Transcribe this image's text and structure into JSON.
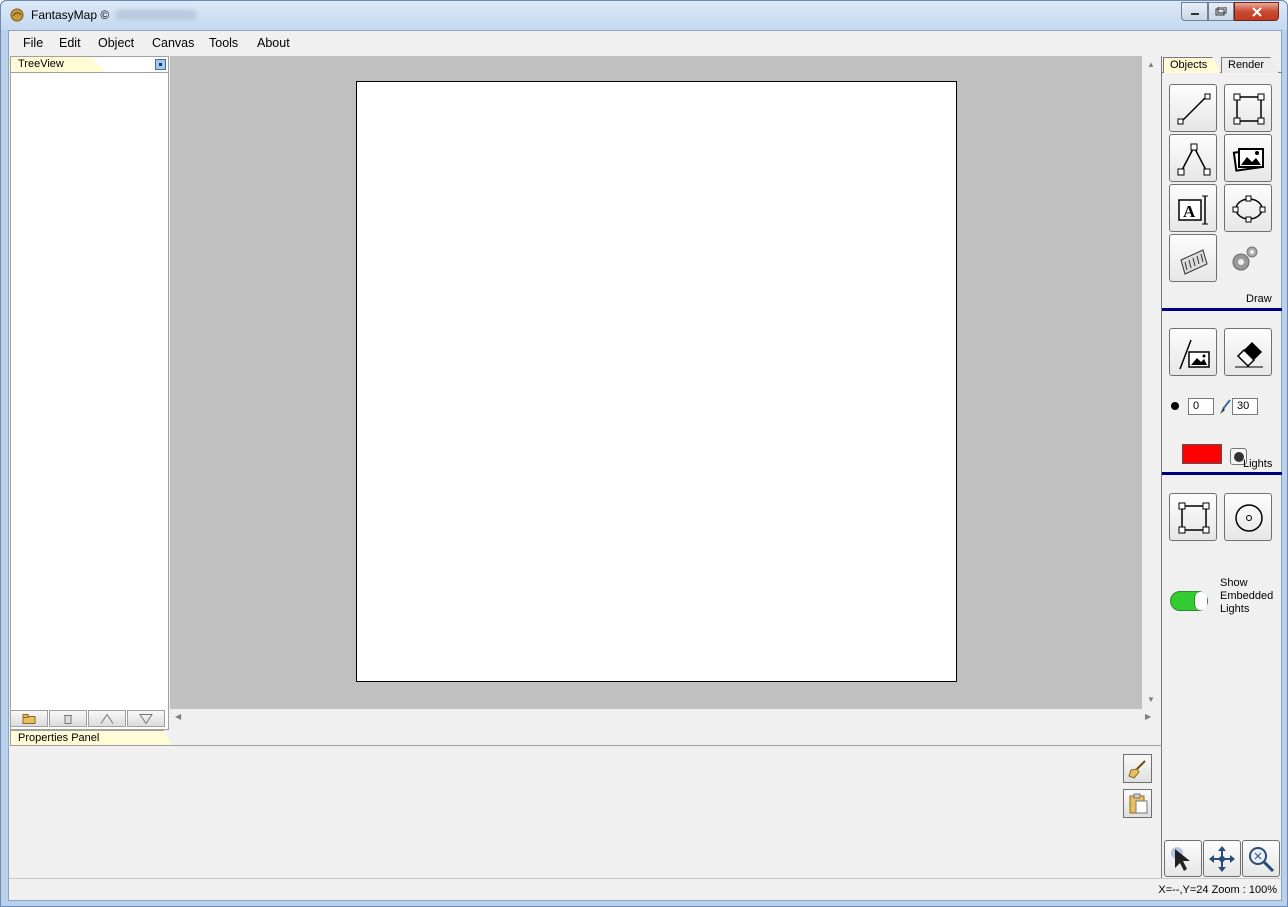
{
  "window": {
    "title": "FantasyMap ©"
  },
  "menu": {
    "items": [
      "File",
      "Edit",
      "Object",
      "Canvas",
      "Tools",
      "About"
    ]
  },
  "treeview": {
    "tab_label": "TreeView"
  },
  "properties": {
    "tab_label": "Properties Panel"
  },
  "right_panel": {
    "tabs": [
      "Objects",
      "Render"
    ],
    "active_tab": "Objects",
    "draw_label": "Draw",
    "lights_label": "Lights",
    "light_radius": "0",
    "brush_size": "30",
    "light_color": "#ff0000",
    "show_embedded_lights_label": "Show Embedded Lights",
    "show_embedded_lights_on": true
  },
  "status": {
    "coords": "X=--,Y=24",
    "zoom": "Zoom : 100%"
  },
  "icons": {
    "draw_tools": [
      "line-icon",
      "rectangle-select-icon",
      "polyline-icon",
      "images-icon",
      "text-icon",
      "ellipse-icon",
      "hatch-icon",
      "gears-icon"
    ],
    "light_tools": [
      "paint-image-icon",
      "eraser-icon"
    ],
    "embedded_tools": [
      "square-nodes-icon",
      "circle-light-icon"
    ],
    "nav_tools": [
      "pointer-icon",
      "pan-icon",
      "zoom-icon"
    ]
  }
}
